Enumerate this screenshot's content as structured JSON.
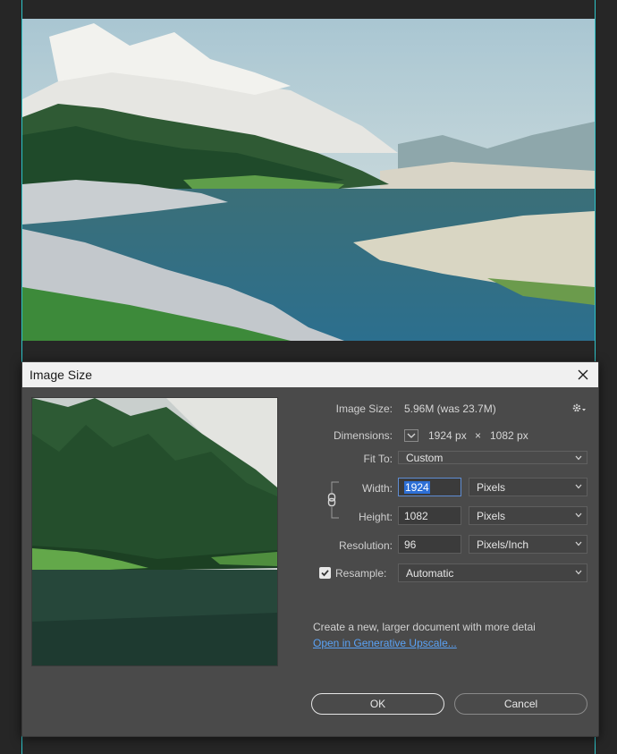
{
  "dialog": {
    "title": "Image Size",
    "image_size_label": "Image Size:",
    "image_size_value": "5.96M (was 23.7M)",
    "dimensions_label": "Dimensions:",
    "dimensions_width": "1924 px",
    "dimensions_x": "×",
    "dimensions_height": "1082 px",
    "fit_to_label": "Fit To:",
    "fit_to_value": "Custom",
    "width_label": "Width:",
    "width_value": "1924",
    "width_unit": "Pixels",
    "height_label": "Height:",
    "height_value": "1082",
    "height_unit": "Pixels",
    "resolution_label": "Resolution:",
    "resolution_value": "96",
    "resolution_unit": "Pixels/Inch",
    "resample_label": "Resample:",
    "resample_checked": true,
    "resample_value": "Automatic",
    "info_text": "Create a new, larger document with more detai",
    "upscale_link": "Open in Generative Upscale...",
    "ok_label": "OK",
    "cancel_label": "Cancel"
  },
  "icons": [
    "close-icon",
    "gear-icon",
    "chevron-down-icon",
    "link-icon",
    "checkmark-icon"
  ],
  "colors": {
    "guide": "#2ec4c8",
    "dialog_bg": "#4a4a4a",
    "titlebar_bg": "#f0f0f0",
    "selection": "#2d6fd6",
    "link": "#5aa2f5"
  }
}
